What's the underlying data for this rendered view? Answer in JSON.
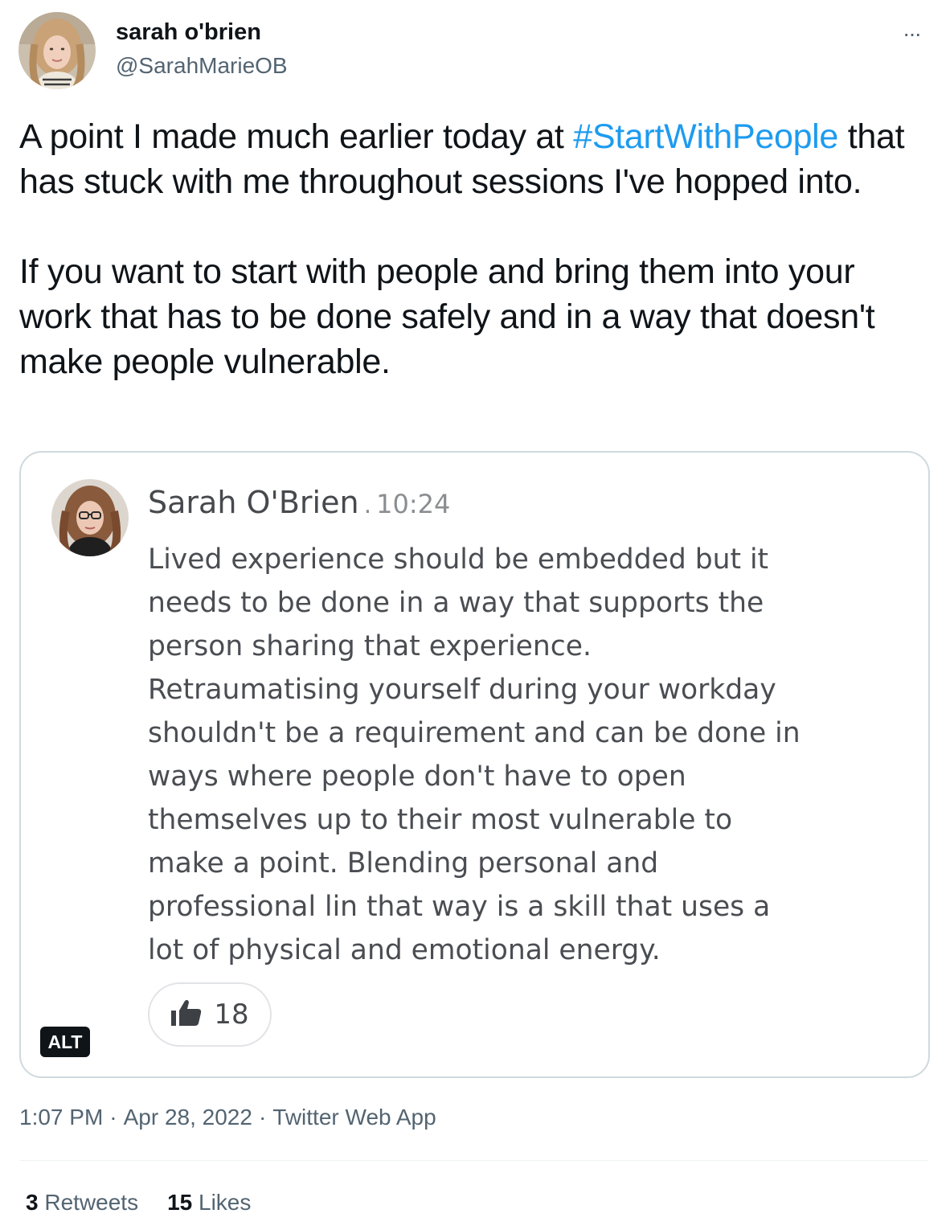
{
  "author": {
    "display_name": "sarah o'brien",
    "handle": "@SarahMarieOB"
  },
  "more_menu": {
    "icon": "more-horizontal-icon",
    "label": "···"
  },
  "tweet": {
    "paragraph1_before": "A point I made much earlier today at ",
    "hashtag": "#StartWithPeople",
    "paragraph1_after": " that has stuck with me throughout sessions I've hopped into.",
    "paragraph2": "If you want to start with people and bring them into your work that has to be done safely and in a way that doesn't make people vulnerable."
  },
  "media": {
    "alt_badge": "ALT",
    "inner_post": {
      "author": "Sarah O'Brien",
      "separator": ".",
      "time": "10:24",
      "message": "Lived experience should be embedded but it\nneeds to be done in a way that supports the\nperson sharing that experience.\nRetraumatising yourself during your workday\nshouldn't be a requirement and can be done in\nways where people don't have to open\nthemselves up to their most vulnerable to\nmake a point. Blending personal and\nprofessional lin that way is a skill that uses a\nlot of physical and emotional energy.",
      "reaction_icon": "thumbs-up-icon",
      "reaction_count": "18"
    }
  },
  "meta": {
    "time": "1:07 PM",
    "date": "Apr 28, 2022",
    "source": "Twitter Web App",
    "separator": "·"
  },
  "stats": {
    "retweets_count": "3",
    "retweets_label": "Retweets",
    "likes_count": "15",
    "likes_label": "Likes"
  },
  "colors": {
    "link": "#1d9bf0",
    "secondary_text": "#536471",
    "primary_text": "#0f1419",
    "border": "#cfd9de"
  }
}
